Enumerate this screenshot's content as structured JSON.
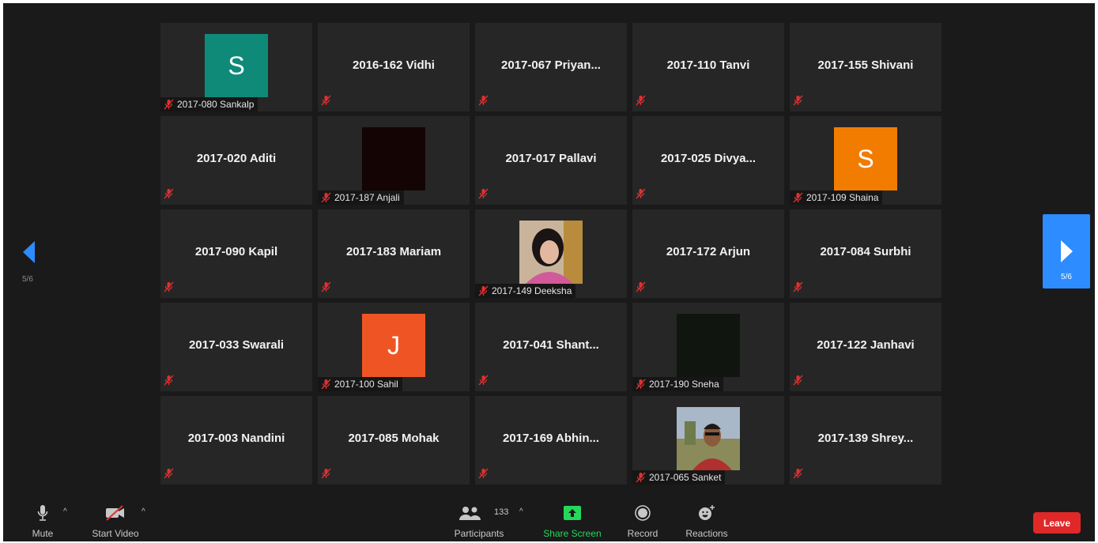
{
  "nav": {
    "page_left": "5/6",
    "page_right": "5/6"
  },
  "tiles": [
    {
      "name": "2017-080 Sankalp",
      "avatar_letter": "S",
      "avatar_color": "#0f8a78"
    },
    {
      "name": "2016-162 Vidhi"
    },
    {
      "name": "2017-067  Priyan..."
    },
    {
      "name": "2017-110 Tanvi"
    },
    {
      "name": "2017-155 Shivani"
    },
    {
      "name": "2017-020 Aditi"
    },
    {
      "name": "2017-187 Anjali",
      "video_color": "#140404"
    },
    {
      "name": "2017-017 Pallavi"
    },
    {
      "name": "2017-025  Divya..."
    },
    {
      "name": "2017-109 Shaina",
      "avatar_letter": "S",
      "avatar_color": "#f27c00"
    },
    {
      "name": "2017-090 Kapil"
    },
    {
      "name": "2017-183 Mariam"
    },
    {
      "name": "2017-149 Deeksha",
      "photo": "woman-portrait"
    },
    {
      "name": "2017-172 Arjun"
    },
    {
      "name": "2017-084 Surbhi"
    },
    {
      "name": "2017-033 Swarali"
    },
    {
      "name": "2017-100 Sahil",
      "avatar_letter": "J",
      "avatar_color": "#ef5524"
    },
    {
      "name": "2017-041  Shant..."
    },
    {
      "name": "2017-190 Sneha",
      "video_color": "#101510"
    },
    {
      "name": "2017-122 Janhavi"
    },
    {
      "name": "2017-003 Nandini"
    },
    {
      "name": "2017-085 Mohak"
    },
    {
      "name": "2017-169  Abhin..."
    },
    {
      "name": "2017-065 Sanket",
      "photo": "man-portrait"
    },
    {
      "name": "2017-139  Shrey..."
    }
  ],
  "toolbar": {
    "mute": "Mute",
    "start_video": "Start Video",
    "participants": "Participants",
    "participants_count": "133",
    "share_screen": "Share Screen",
    "record": "Record",
    "reactions": "Reactions",
    "leave": "Leave"
  },
  "colors": {
    "share_green": "#23d959",
    "leave_red": "#e02828",
    "page_blue": "#2d8cff",
    "muted_mic_red": "#e03030"
  }
}
